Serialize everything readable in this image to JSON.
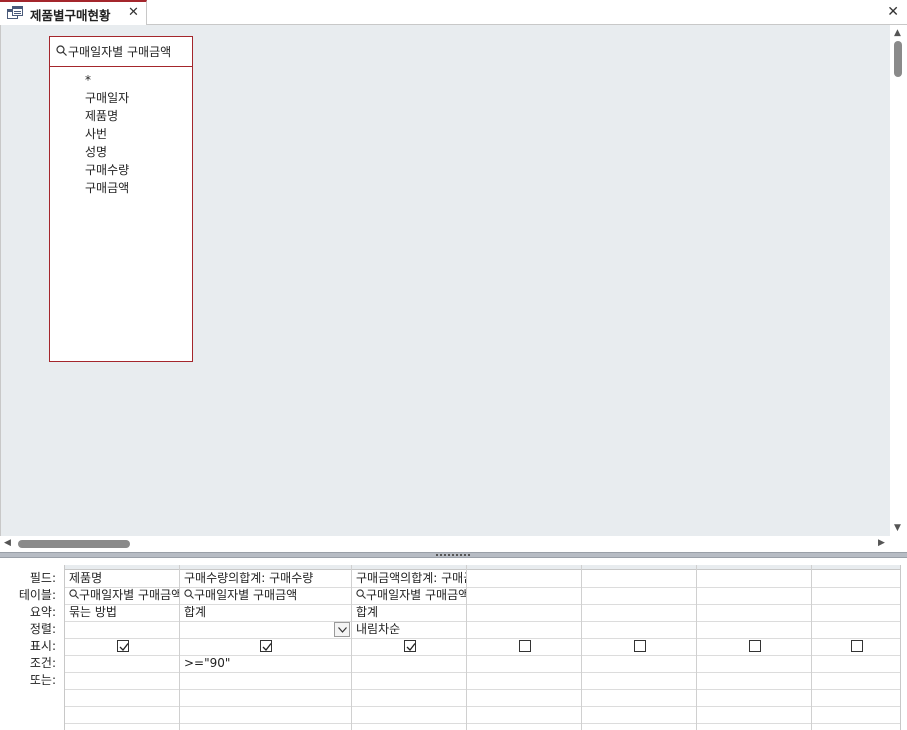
{
  "tab": {
    "title": "제품별구매현황",
    "close_glyph": "✕"
  },
  "window": {
    "close_glyph": "✕"
  },
  "source_table": {
    "title": "구매일자별 구매금액",
    "fields": [
      "*",
      "구매일자",
      "제품명",
      "사번",
      "성명",
      "구매수량",
      "구매금액"
    ]
  },
  "grid": {
    "row_labels": [
      "필드:",
      "테이블:",
      "요약:",
      "정렬:",
      "표시:",
      "조건:",
      "또는:"
    ],
    "columns": [
      {
        "field": "제품명",
        "table": "구매일자별 구매금액",
        "total": "묶는 방법",
        "sort": "",
        "show": true,
        "criteria": "",
        "or": ""
      },
      {
        "field": "구매수량의합계: 구매수량",
        "table": "구매일자별 구매금액",
        "total": "합계",
        "sort": "",
        "show": true,
        "criteria": ">=\"90\"",
        "or": ""
      },
      {
        "field": "구매금액의합계: 구매금액",
        "table": "구매일자별 구매금액",
        "total": "합계",
        "sort": "내림차순",
        "show": true,
        "criteria": "",
        "or": ""
      },
      {
        "field": "",
        "table": "",
        "total": "",
        "sort": "",
        "show": false,
        "criteria": "",
        "or": ""
      },
      {
        "field": "",
        "table": "",
        "total": "",
        "sort": "",
        "show": false,
        "criteria": "",
        "or": ""
      },
      {
        "field": "",
        "table": "",
        "total": "",
        "sort": "",
        "show": false,
        "criteria": "",
        "or": ""
      },
      {
        "field": "",
        "table": "",
        "total": "",
        "sort": "",
        "show": false,
        "criteria": "",
        "or": ""
      }
    ]
  },
  "colors": {
    "accent": "#a4262c",
    "pane_bg": "#e8ecef"
  }
}
